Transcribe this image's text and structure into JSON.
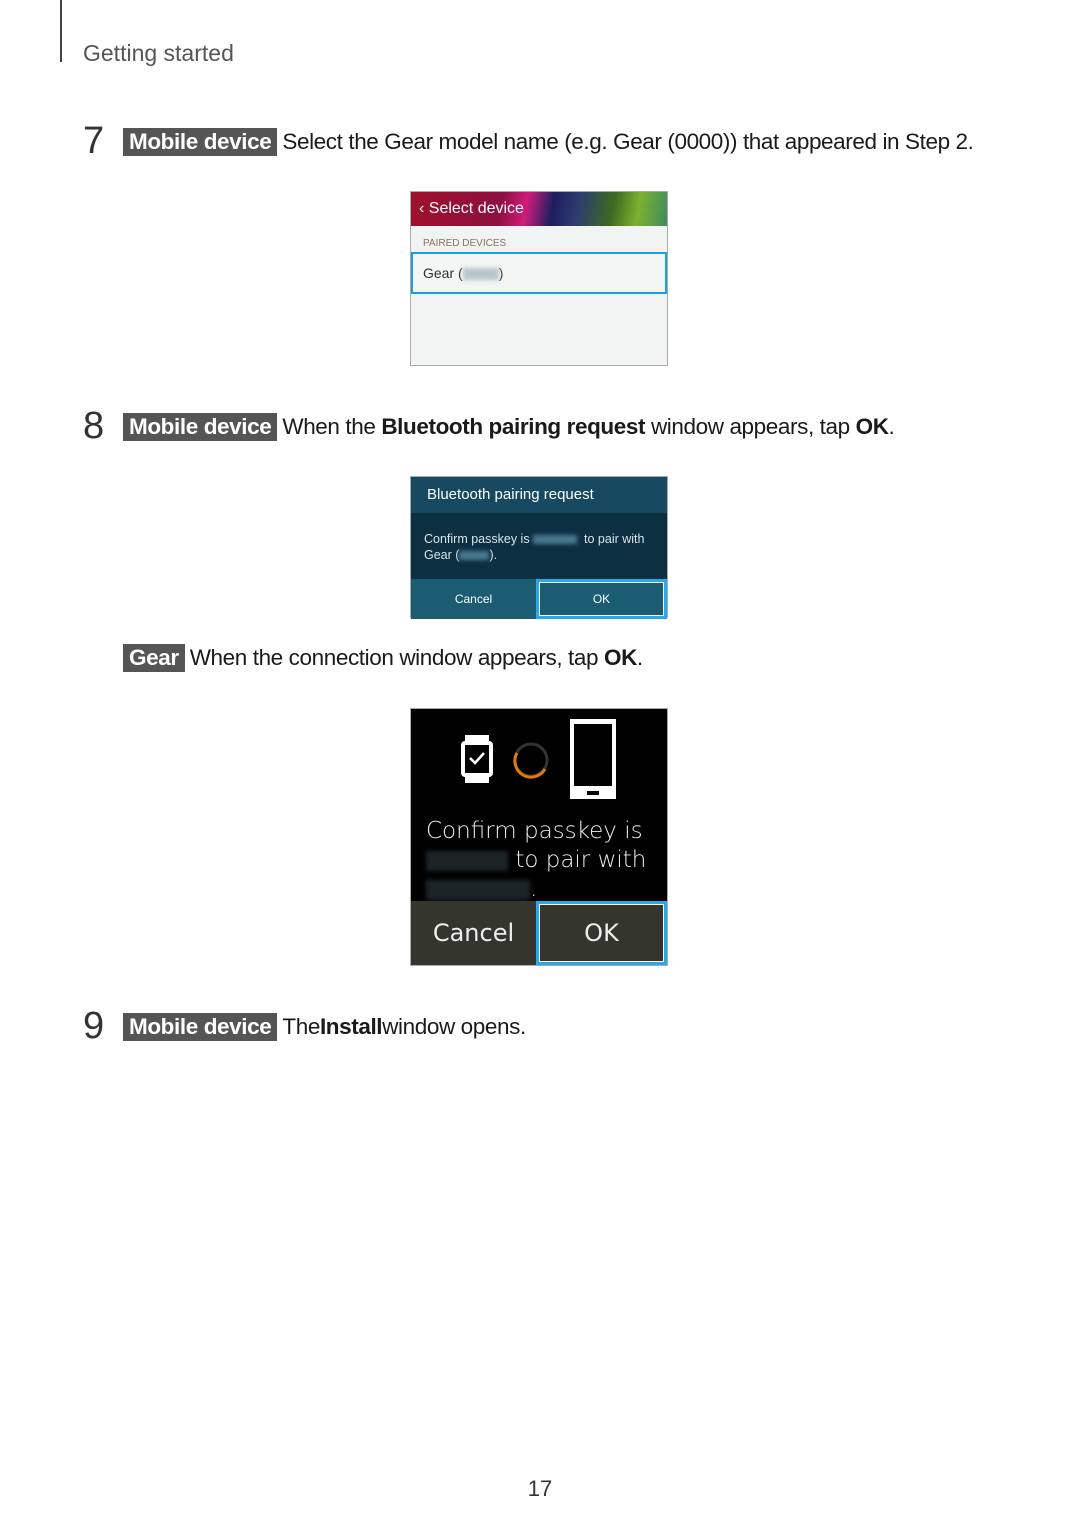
{
  "header": {
    "section": "Getting started"
  },
  "step7": {
    "num": "7",
    "tag": "Mobile device",
    "text": "Select the Gear model name (e.g. Gear (0000)) that appeared in Step 2."
  },
  "shot1": {
    "title": "Select device",
    "section": "PAIRED DEVICES",
    "item_prefix": "Gear (",
    "item_suffix": ")"
  },
  "step8": {
    "num": "8",
    "tag": "Mobile device",
    "pre": "When the ",
    "bold1": "Bluetooth pairing request",
    "mid": " window appears, tap ",
    "bold2": "OK",
    "post": "."
  },
  "shot2": {
    "title": "Bluetooth pairing request",
    "msg1": "Confirm passkey is ",
    "msg2": " to pair with",
    "msg3": "Gear (",
    "msg4": ").",
    "cancel": "Cancel",
    "ok": "OK"
  },
  "gear_step": {
    "tag": "Gear",
    "pre": "When the connection window appears, tap ",
    "bold": "OK",
    "post": "."
  },
  "shot3": {
    "line1": "Confirm passkey is",
    "line2": "to pair with",
    "line3": ".",
    "cancel": "Cancel",
    "ok": "OK",
    "spinner_color": "#e07a10"
  },
  "step9": {
    "num": "9",
    "tag": "Mobile device",
    "pre": "The ",
    "bold": "Install",
    "post": " window opens."
  },
  "page_number": "17"
}
